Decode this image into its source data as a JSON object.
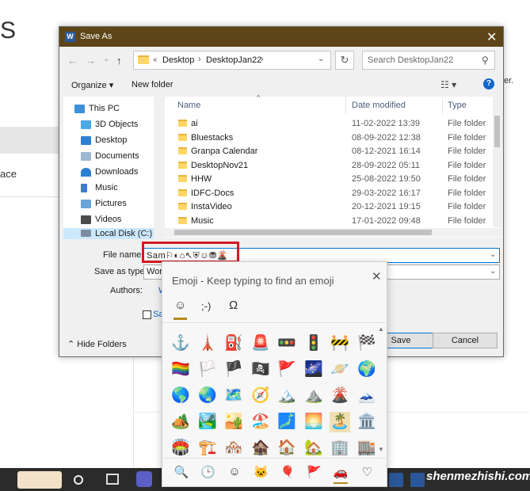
{
  "background": {
    "letter_s": "S",
    "ace": "ace",
    "right_fragment": "er."
  },
  "taskbar": {
    "watermark": "shenmezhishi.com"
  },
  "dialog": {
    "title": "Save As",
    "app_icon_letter": "W",
    "nav": {
      "back": "←",
      "forward": "→",
      "recent": "⌄",
      "up": "↑"
    },
    "address": {
      "chevron": "«",
      "parts": [
        "Desktop",
        "DesktopJan22"
      ]
    },
    "search_placeholder": "Search DesktopJan22",
    "toolbar": {
      "organize": "Organize ▾",
      "new_folder": "New folder",
      "view": "☷ ▾",
      "help": "?"
    },
    "nav_pane": [
      {
        "label": "This PC",
        "icon": "this-pc-icon"
      },
      {
        "label": "3D Objects",
        "icon": "3d-objects-icon"
      },
      {
        "label": "Desktop",
        "icon": "desktop-icon"
      },
      {
        "label": "Documents",
        "icon": "documents-icon"
      },
      {
        "label": "Downloads",
        "icon": "downloads-icon"
      },
      {
        "label": "Music",
        "icon": "music-icon"
      },
      {
        "label": "Pictures",
        "icon": "pictures-icon"
      },
      {
        "label": "Videos",
        "icon": "videos-icon"
      },
      {
        "label": "Local Disk (C:)",
        "icon": "disk-icon"
      }
    ],
    "columns": {
      "name": "Name",
      "date": "Date modified",
      "type": "Type"
    },
    "files": [
      {
        "name": "ai",
        "date": "11-02-2022 13:39",
        "type": "File folder"
      },
      {
        "name": "Bluestacks",
        "date": "08-09-2022 12:38",
        "type": "File folder"
      },
      {
        "name": "Granpa Calendar",
        "date": "08-12-2021 16:14",
        "type": "File folder"
      },
      {
        "name": "DesktopNov21",
        "date": "28-09-2022 05:11",
        "type": "File folder"
      },
      {
        "name": "HHW",
        "date": "25-08-2022 19:50",
        "type": "File folder"
      },
      {
        "name": "IDFC-Docs",
        "date": "29-03-2022 16:17",
        "type": "File folder"
      },
      {
        "name": "InstaVideo",
        "date": "20-12-2021 19:15",
        "type": "File folder"
      },
      {
        "name": "Music",
        "date": "17-01-2022 09:48",
        "type": "File folder"
      }
    ],
    "form": {
      "file_name_label": "File name:",
      "file_name_value": "Sam⚐◐⌂↖⛨☺⛃🌋",
      "save_as_type_label": "Save as type:",
      "save_as_type_value": "Word",
      "authors_label": "Authors:",
      "authors_value": "Win",
      "tags_partial": "Sa"
    },
    "hide_folders": "Hide Folders",
    "save_button": "Save",
    "cancel_button": "Cancel"
  },
  "emoji_panel": {
    "title": "Emoji - Keep typing to find an emoji",
    "close": "✕",
    "tabs": [
      "☺",
      ";-)",
      "Ω"
    ],
    "rows": [
      [
        "⚓",
        "🗼",
        "⛽",
        "🚨",
        "🚥",
        "🚦",
        "🚧",
        "🏁"
      ],
      [
        "🏳️‍🌈",
        "🏳️",
        "🏴",
        "🏴‍☠️",
        "🚩",
        "🌌",
        "🪐",
        "🌍"
      ],
      [
        "🌎",
        "🌏",
        "🗺️",
        "🧭",
        "🏔️",
        "⛰️",
        "🌋",
        "🗻"
      ],
      [
        "🏕️",
        "🏞️",
        "🏜️",
        "🏖️",
        "🗾",
        "🌅",
        "🏝️",
        "🏛️"
      ],
      [
        "🏟️",
        "🏗️",
        "🏘️",
        "🏚️",
        "🏠",
        "🏡",
        "🏢",
        "🏬"
      ]
    ],
    "selected_index": [
      3,
      6
    ],
    "categories": [
      "🔍",
      "🕒",
      "☺",
      "🐱",
      "🎈",
      "🚩",
      "🚗",
      "♡"
    ]
  }
}
